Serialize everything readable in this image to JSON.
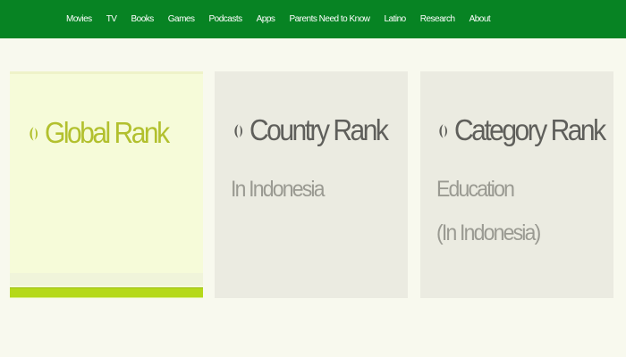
{
  "nav": {
    "items": [
      {
        "label": "Movies"
      },
      {
        "label": "TV"
      },
      {
        "label": "Books"
      },
      {
        "label": "Games"
      },
      {
        "label": "Podcasts"
      },
      {
        "label": "Apps"
      },
      {
        "label": "Parents Need to Know"
      },
      {
        "label": "Latino"
      },
      {
        "label": "Research"
      },
      {
        "label": "About"
      }
    ]
  },
  "colors": {
    "nav_background": "#078323",
    "global_accent": "#b2c02e",
    "progress_fill": "#b5d91a",
    "card_text": "#5f5f5b",
    "sub_text": "#9a9a92"
  },
  "cards": {
    "global": {
      "title": "Global Rank",
      "icon": "leaf-icon",
      "progress": 1.0
    },
    "country": {
      "title": "Country Rank",
      "icon": "leaf-icon",
      "subtitle": "In Indonesia"
    },
    "category": {
      "title": "Category Rank",
      "icon": "leaf-icon",
      "subtitle_line1": "Education",
      "subtitle_line2": "(In Indonesia)"
    }
  }
}
